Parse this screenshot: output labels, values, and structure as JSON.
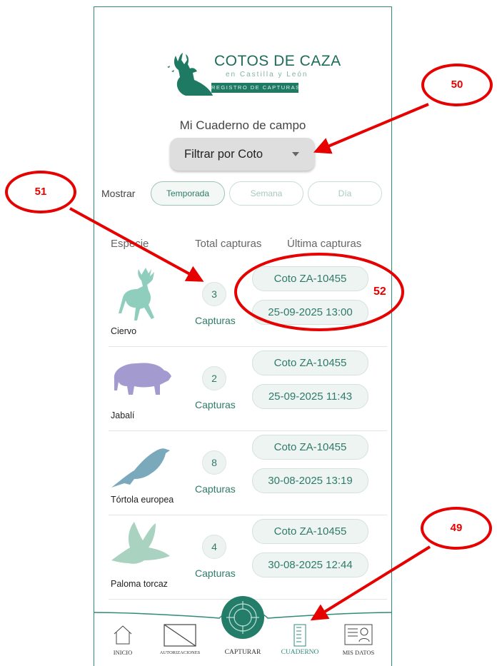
{
  "logo": {
    "title": "COTOS DE CAZA",
    "subtitle": "en Castilla y León",
    "band": "REGISTRO DE CAPTURAS"
  },
  "page_title": "Mi Cuaderno de campo",
  "filter": {
    "label": "Filtrar por Coto"
  },
  "show": {
    "label": "Mostrar",
    "options": [
      "Temporada",
      "Semana",
      "Día"
    ],
    "selected": "Temporada"
  },
  "columns": {
    "species": "Especie",
    "total": "Total capturas",
    "last": "Última capturas"
  },
  "rows": [
    {
      "species": "Ciervo",
      "count": "3",
      "count_label": "Capturas",
      "coto": "Coto  ZA-10455",
      "date": "25-09-2025 13:00",
      "icon": "deer-icon",
      "color": "#7fbfb0"
    },
    {
      "species": "Jabalí",
      "count": "2",
      "count_label": "Capturas",
      "coto": "Coto  ZA-10455",
      "date": "25-09-2025 11:43",
      "icon": "boar-icon",
      "color": "#9b93c7"
    },
    {
      "species": "Tórtola europea",
      "count": "8",
      "count_label": "Capturas",
      "coto": "Coto  ZA-10455",
      "date": "30-08-2025 13:19",
      "icon": "turtle-dove-icon",
      "color": "#6f9fb3"
    },
    {
      "species": "Paloma torcaz",
      "count": "4",
      "count_label": "Capturas",
      "coto": "Coto  ZA-10455",
      "date": "30-08-2025 12:44",
      "icon": "wood-pigeon-icon",
      "color": "#9fc9b6"
    }
  ],
  "nav": [
    {
      "label": "INICIO",
      "icon": "home-icon"
    },
    {
      "label": "AUTORIZACIONES",
      "icon": "authorizations-icon"
    },
    {
      "label": "CAPTURAR",
      "icon": "target-icon"
    },
    {
      "label": "CUADERNO",
      "icon": "notebook-icon",
      "active": true
    },
    {
      "label": "MIS DATOS",
      "icon": "profile-card-icon"
    }
  ],
  "annotations": [
    "50",
    "51",
    "52",
    "49"
  ],
  "colors": {
    "accent": "#2f8a78",
    "annotation": "#e60000"
  }
}
